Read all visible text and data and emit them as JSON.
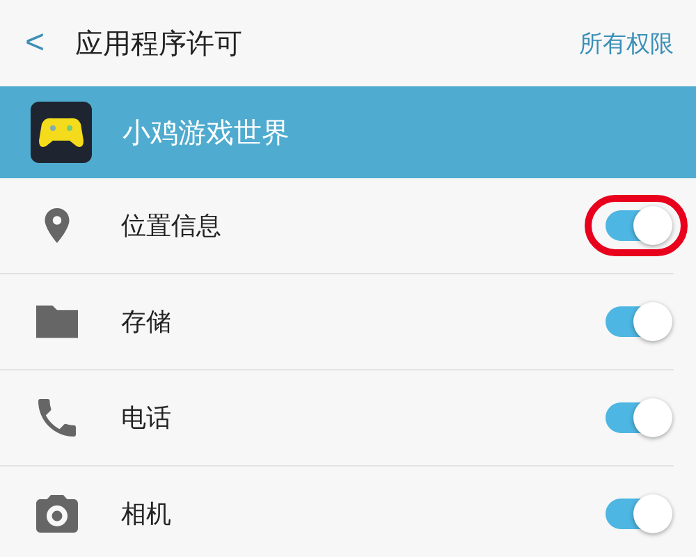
{
  "header": {
    "back": "<",
    "title": "应用程序许可",
    "action": "所有权限"
  },
  "app": {
    "name": "小鸡游戏世界"
  },
  "permissions": [
    {
      "label": "位置信息",
      "on": true,
      "highlighted": true
    },
    {
      "label": "存储",
      "on": true,
      "highlighted": false
    },
    {
      "label": "电话",
      "on": true,
      "highlighted": false
    },
    {
      "label": "相机",
      "on": true,
      "highlighted": false
    }
  ]
}
